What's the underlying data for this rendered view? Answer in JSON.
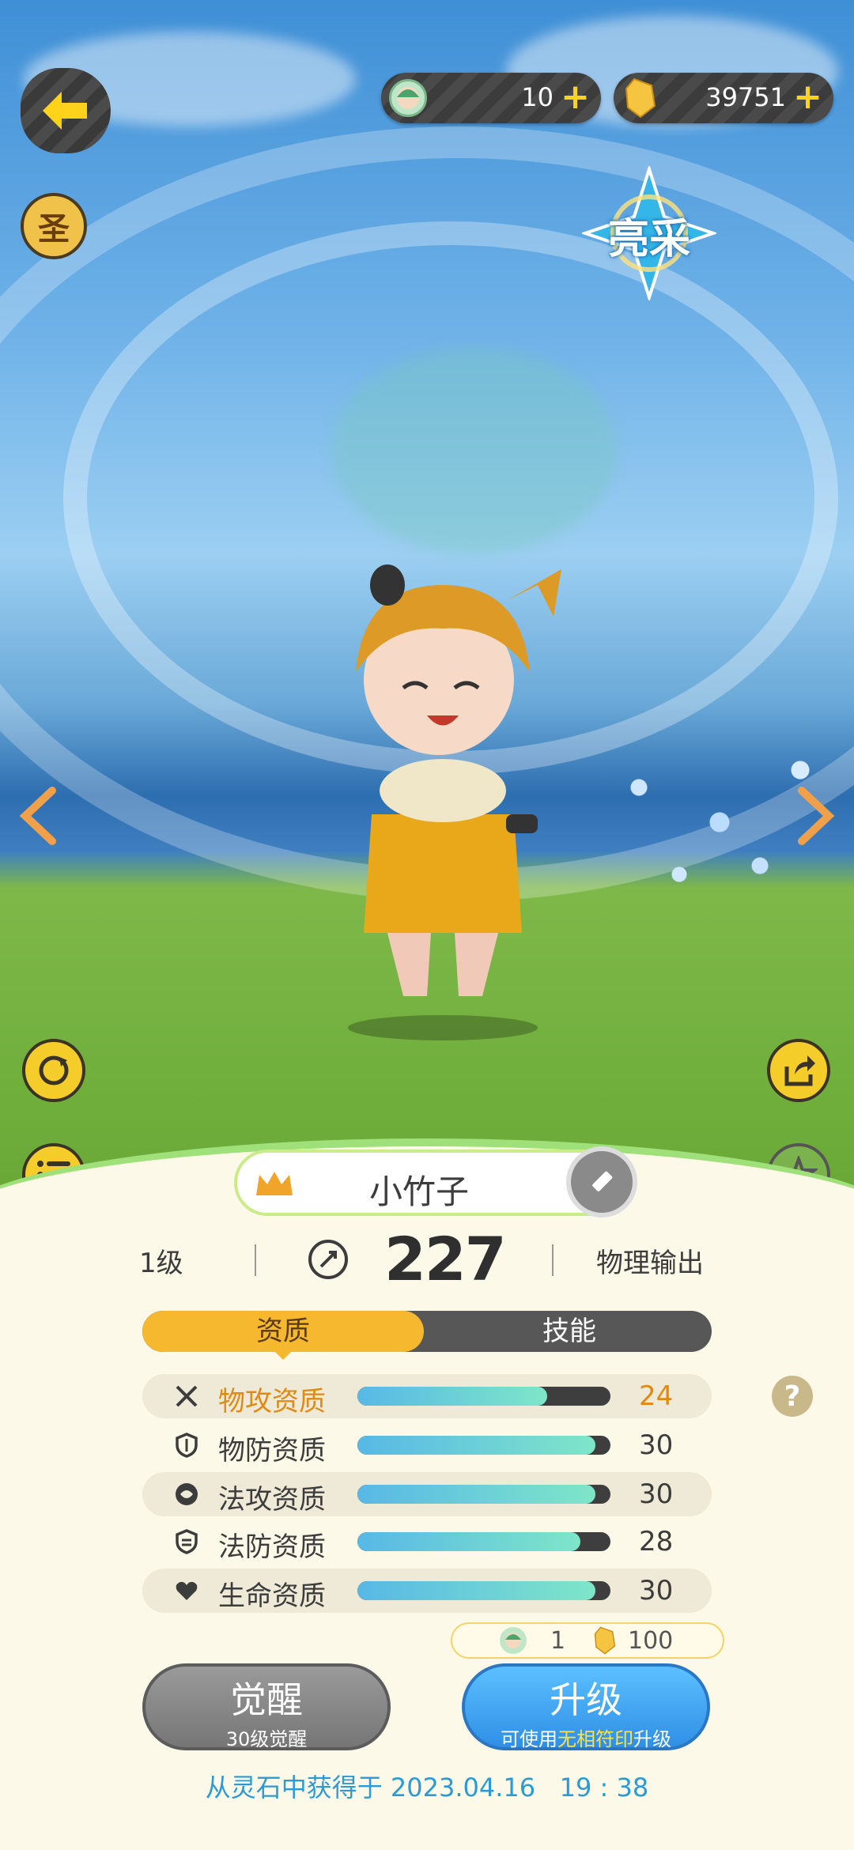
{
  "topbar": {
    "currency1": {
      "icon": "spirit-face-icon",
      "value": "10"
    },
    "currency2": {
      "icon": "gold-crystal-icon",
      "value": "39751"
    },
    "plus": "+"
  },
  "side": {
    "holy_badge": "圣",
    "rarity_badge": "亮采"
  },
  "pet": {
    "name": "小竹子",
    "level": "1级",
    "power": "227",
    "type": "物理输出"
  },
  "tabs": [
    {
      "label": "资质",
      "active": true
    },
    {
      "label": "技能",
      "active": false
    }
  ],
  "stats": [
    {
      "label": "物攻资质",
      "value": "24",
      "fill": 0.75,
      "highlight": true,
      "icon": "sword-icon"
    },
    {
      "label": "物防资质",
      "value": "30",
      "fill": 0.94,
      "highlight": false,
      "icon": "shield-icon"
    },
    {
      "label": "法攻资质",
      "value": "30",
      "fill": 0.94,
      "highlight": false,
      "icon": "magic-orb-icon"
    },
    {
      "label": "法防资质",
      "value": "28",
      "fill": 0.88,
      "highlight": false,
      "icon": "magic-shield-icon"
    },
    {
      "label": "生命资质",
      "value": "30",
      "fill": 0.94,
      "highlight": false,
      "icon": "heart-icon"
    }
  ],
  "cost": {
    "spirit": "1",
    "gold": "100"
  },
  "buttons": {
    "awaken": {
      "title": "觉醒",
      "sub": "30级觉醒"
    },
    "upgrade": {
      "title": "升级",
      "sub_prefix": "可使用",
      "sub_highlight": "无相符印",
      "sub_suffix": "升级"
    }
  },
  "footer": "从灵石中获得于 2023.04.16   19 : 38",
  "colors": {
    "accent": "#f5b82e",
    "highlight_text": "#e08a12",
    "upgrade_blue": "#3aa0f0",
    "footer_text": "#2a9bd6"
  }
}
